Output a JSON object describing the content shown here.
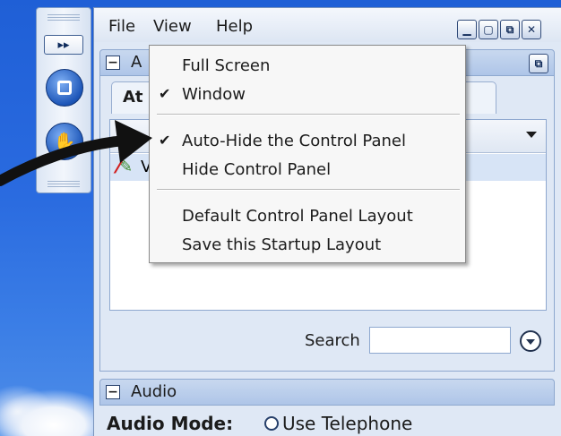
{
  "menubar": {
    "items": [
      "File",
      "View",
      "Help"
    ]
  },
  "window_buttons": [
    "minimize",
    "restore",
    "dock",
    "close"
  ],
  "attendee_panel": {
    "title": "A",
    "tab_label": "At"
  },
  "list": {
    "row_label": "V"
  },
  "search": {
    "label": "Search",
    "value": ""
  },
  "audio_panel": {
    "title": "Audio",
    "mode_label": "Audio Mode:",
    "option_label": "Use Telephone"
  },
  "view_menu": {
    "items": [
      {
        "label": "Full Screen",
        "checked": false
      },
      {
        "label": "Window",
        "checked": true
      },
      {
        "label": "Auto-Hide the Control Panel",
        "checked": true
      },
      {
        "label": "Hide Control Panel",
        "checked": false
      },
      {
        "label": "Default Control Panel Layout",
        "checked": false
      },
      {
        "label": "Save this Startup Layout",
        "checked": false
      }
    ],
    "check_glyph": "✔"
  },
  "mini_toolbar": {
    "expand_glyph": "▸▸"
  },
  "colors": {
    "desktop": "#1f5fd6",
    "panel_header": "#aec5e8",
    "annotation_arrow": "#111111"
  }
}
